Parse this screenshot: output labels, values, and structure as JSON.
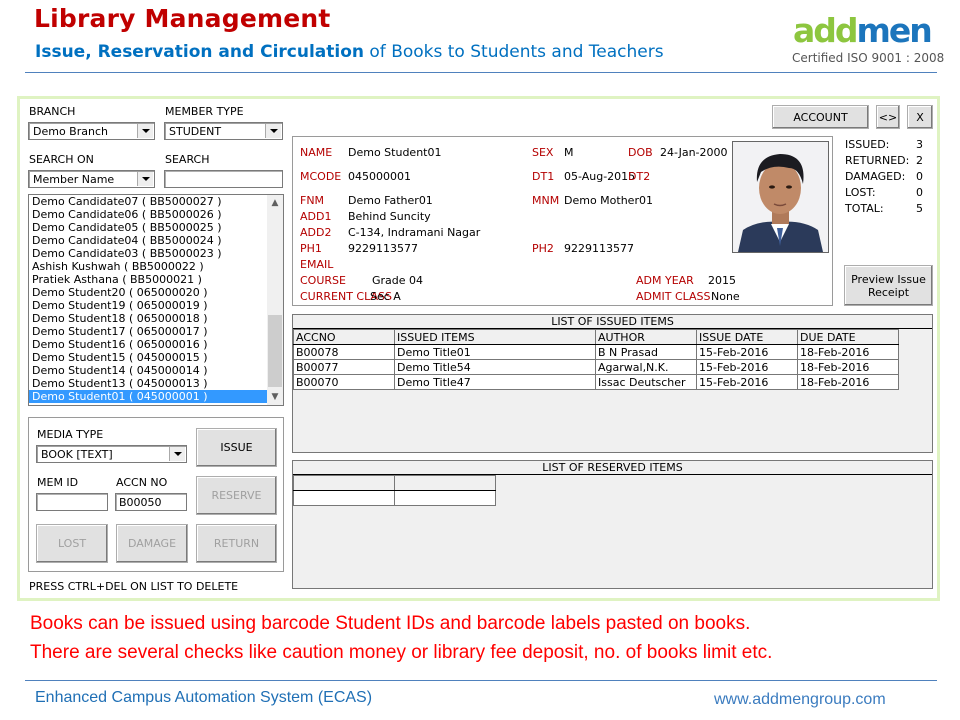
{
  "header": {
    "title": "Library Management",
    "subtitle_bold": "Issue, Reservation and Circulation",
    "subtitle_rest": " of Books to Students and Teachers",
    "logo_part1": "add",
    "logo_part2": "men",
    "certification": "Certified ISO 9001 : 2008"
  },
  "filters": {
    "branch_label": "BRANCH",
    "branch_value": "Demo Branch",
    "member_type_label": "MEMBER TYPE",
    "member_type_value": "STUDENT",
    "search_on_label": "SEARCH ON",
    "search_on_value": "Member Name",
    "search_label": "SEARCH",
    "search_value": ""
  },
  "member_list": [
    "Demo Candidate07 ( BB5000027 )",
    "Demo Candidate06 ( BB5000026 )",
    "Demo Candidate05 ( BB5000025 )",
    "Demo Candidate04 ( BB5000024 )",
    "Demo Candidate03 ( BB5000023 )",
    "Ashish Kushwah ( BB5000022 )",
    "Pratiek Asthana  ( BB5000021 )",
    "Demo Student20 ( 065000020 )",
    "Demo Student19 ( 065000019 )",
    "Demo Student18 ( 065000018 )",
    "Demo Student17 ( 065000017 )",
    "Demo Student16 ( 065000016 )",
    "Demo Student15 ( 045000015 )",
    "Demo Student14 ( 045000014 )",
    "Demo Student13 ( 045000013 )",
    "Demo Student01 ( 045000001 )"
  ],
  "selected_member_index": 15,
  "issue_panel": {
    "media_type_label": "MEDIA TYPE",
    "media_type_value": "BOOK [TEXT]",
    "mem_id_label": "MEM ID",
    "mem_id_value": "",
    "accn_no_label": "ACCN NO",
    "accn_no_value": "B00050",
    "issue_button": "ISSUE",
    "reserve_button": "RESERVE",
    "lost_button": "LOST",
    "damage_button": "DAMAGE",
    "return_button": "RETURN",
    "hint": "PRESS CTRL+DEL ON LIST TO DELETE"
  },
  "toolbar": {
    "account_button": "ACCOUNT",
    "toggle_button": "<>",
    "close_button": "X",
    "preview_button": "Preview Issue Receipt"
  },
  "member": {
    "name_label": "NAME",
    "name": "Demo Student01",
    "sex_label": "SEX",
    "sex": "M",
    "dob_label": "DOB",
    "dob": "24-Jan-2000",
    "mcode_label": "MCODE",
    "mcode": "045000001",
    "dt1_label": "DT1",
    "dt1": "05-Aug-2015",
    "dt2_label": "DT2",
    "dt2": "",
    "fnm_label": "FNM",
    "fnm": "Demo Father01",
    "mnm_label": "MNM",
    "mnm": "Demo Mother01",
    "add1_label": "ADD1",
    "add1": "Behind Suncity",
    "add2_label": "ADD2",
    "add2": "C-134, Indramani Nagar",
    "ph1_label": "PH1",
    "ph1": "9229113577",
    "ph2_label": "PH2",
    "ph2": "9229113577",
    "email_label": "EMAIL",
    "email": "",
    "course_label": "COURSE",
    "course": "Grade 04",
    "adm_year_label": "ADM YEAR",
    "adm_year": "2015",
    "current_class_label": "CURRENT CLASS",
    "current_class": "Sec A",
    "admit_class_label": "ADMIT CLASS",
    "admit_class": "None"
  },
  "stats": [
    {
      "label": "ISSUED:",
      "value": "3"
    },
    {
      "label": "RETURNED:",
      "value": "2"
    },
    {
      "label": "DAMAGED:",
      "value": "0"
    },
    {
      "label": "LOST:",
      "value": "0"
    },
    {
      "label": "TOTAL:",
      "value": "5"
    }
  ],
  "issued_items": {
    "title": "LIST OF ISSUED ITEMS",
    "columns": [
      "ACCNO",
      "ISSUED ITEMS",
      "AUTHOR",
      "ISSUE DATE",
      "DUE DATE"
    ],
    "rows": [
      [
        "B00078",
        "Demo Title01",
        "B N Prasad",
        "15-Feb-2016",
        "18-Feb-2016"
      ],
      [
        "B00077",
        "Demo Title54",
        "Agarwal,N.K.",
        "15-Feb-2016",
        "18-Feb-2016"
      ],
      [
        "B00070",
        "Demo Title47",
        "Issac  Deutscher",
        "15-Feb-2016",
        "18-Feb-2016"
      ]
    ]
  },
  "reserved_items": {
    "title": "LIST OF RESERVED ITEMS",
    "columns": [
      "",
      ""
    ],
    "rows": [
      [
        "",
        ""
      ]
    ]
  },
  "notes": [
    "Books can be issued using barcode Student IDs and barcode labels pasted on books.",
    "There are several checks like caution money  or library fee deposit, no. of books limit etc."
  ],
  "footer": {
    "left": "Enhanced Campus Automation System (ECAS)",
    "right": "www.addmengroup.com"
  }
}
